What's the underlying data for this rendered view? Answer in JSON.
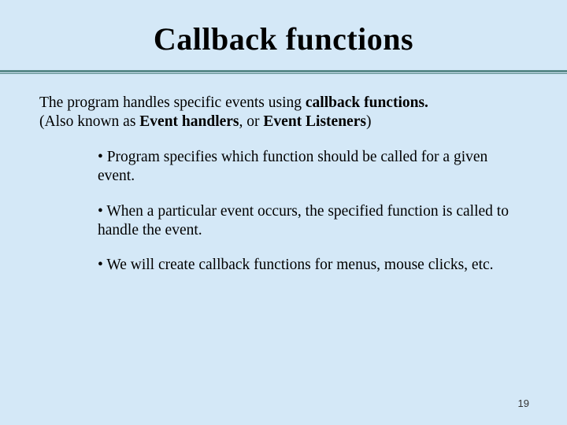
{
  "title": "Callback functions",
  "intro": {
    "pre": "The program handles specific events using ",
    "bold1": "callback functions.",
    "line2_pre": "(Also known as ",
    "bold2": "Event handlers",
    "mid": ", or ",
    "bold3": "Event Listeners",
    "post": ")"
  },
  "bullets": [
    "Program specifies which function should be called for a given event.",
    "When a particular event occurs, the specified function is called to handle the event.",
    "We will create callback functions for menus, mouse clicks, etc."
  ],
  "page_number": "19"
}
